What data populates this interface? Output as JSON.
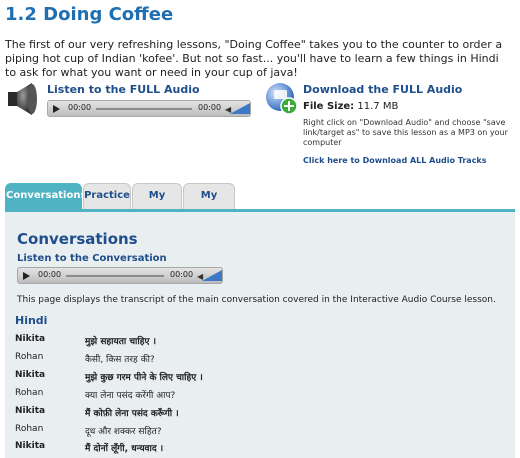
{
  "page": {
    "title": "1.2 Doing Coffee",
    "intro": "The first of our very refreshing lessons, \"Doing Coffee\" takes you to the counter to order a piping hot cup of Indian 'kofee'. But not so fast... you'll have to learn a few things in Hindi to ask for what you want or need in your cup of java!"
  },
  "full_audio": {
    "title": "Listen to the FULL Audio",
    "time_current": "00:00",
    "time_total": "00:00"
  },
  "download": {
    "title": "Download the FULL Audio",
    "file_size_label": "File Size:",
    "file_size_value": "11.7 MB",
    "note": "Right click on \"Download Audio\" and choose \"save link/target as\" to save this lesson as a MP3 on your computer",
    "all_link": "Click here to Download ALL Audio Tracks"
  },
  "tabs": [
    {
      "label": "Conversations",
      "active": true
    },
    {
      "label": "Practice",
      "active": false
    },
    {
      "label": "My Level",
      "active": false
    },
    {
      "label": "My Notes",
      "active": false
    }
  ],
  "panel": {
    "heading": "Conversations",
    "listen_label": "Listen to the Conversation",
    "time_current": "00:00",
    "time_total": "00:00",
    "description": "This page displays the transcript of the main conversation covered in the Interactive Audio Course lesson.",
    "language": "Hindi",
    "lines": [
      {
        "speaker": "Nikita",
        "text": "मुझे सहायता चाहिए ।"
      },
      {
        "speaker": "Rohan",
        "text": "कैसी, किस तरह की?"
      },
      {
        "speaker": "Nikita",
        "text": "मुझे कुछ गरम पीने के लिए चाहिए ।"
      },
      {
        "speaker": "Rohan",
        "text": "क्या लेना पसंद करेंगी आप?"
      },
      {
        "speaker": "Nikita",
        "text": "मैं कोफ़ी लेना पसंद करूँगी ।"
      },
      {
        "speaker": "Rohan",
        "text": "दूध और शक्कर सहित?"
      },
      {
        "speaker": "Nikita",
        "text": "मैं दोनों लूँगी, धन्यवाद ।"
      }
    ]
  },
  "colors": {
    "heading_blue": "#1f6fb2",
    "link_blue": "#1f4e8c",
    "tab_active": "#4fb3c3",
    "panel_bg": "#e9eef1"
  }
}
